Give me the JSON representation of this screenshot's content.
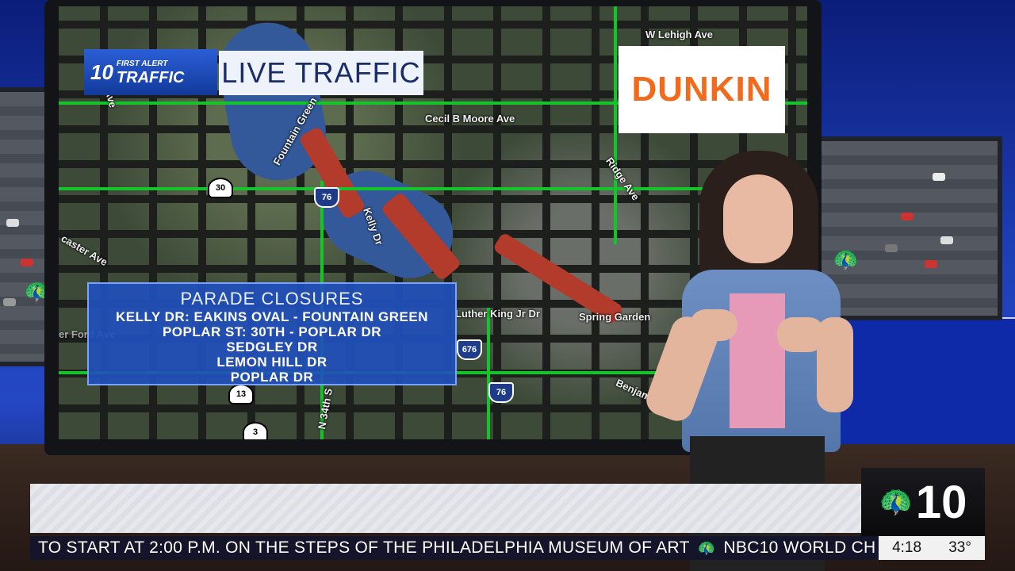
{
  "logo": {
    "channel": "10",
    "line1": "FIRST ALERT",
    "line2": "TRAFFIC"
  },
  "title": "LIVE TRAFFIC",
  "sponsor": "DUNKIN",
  "closures": {
    "heading": "PARADE CLOSURES",
    "items": [
      "KELLY DR: EAKINS OVAL - FOUNTAIN GREEN",
      "POPLAR ST: 30TH - POPLAR DR",
      "SEDGLEY DR",
      "LEMON HILL DR",
      "POPLAR DR"
    ]
  },
  "map_labels": {
    "lehigh": "W Lehigh Ave",
    "cecil": "Cecil B Moore Ave",
    "fountain": "Fountain Green",
    "kelly": "Kelly Dr",
    "ridge": "Ridge Ave",
    "belmont": "lmont Ave",
    "lancaster": "caster Ave",
    "mlk": "Luther King Jr Dr",
    "spring": "Spring Garden",
    "ben": "Benjamin Fr",
    "n34": "N 34th S",
    "ford": "er Ford Ave"
  },
  "shields": {
    "us30": "30",
    "i76a": "76",
    "i676": "676",
    "i76b": "76",
    "r13": "13",
    "r3": "3"
  },
  "ticker": {
    "text": "TO START AT 2:00 P.M. ON THE STEPS OF THE PHILADELPHIA MUSEUM OF ART",
    "next": "NBC10 WORLD CH"
  },
  "bug": {
    "channel": "10",
    "time": "4:18",
    "temp": "33°"
  },
  "colors": {
    "brand_blue": "#214fbc",
    "dunkin_orange": "#f26a1b",
    "dunkin_pink": "#e2208c",
    "congestion": "#b33b2c",
    "flow": "#15c42a"
  }
}
